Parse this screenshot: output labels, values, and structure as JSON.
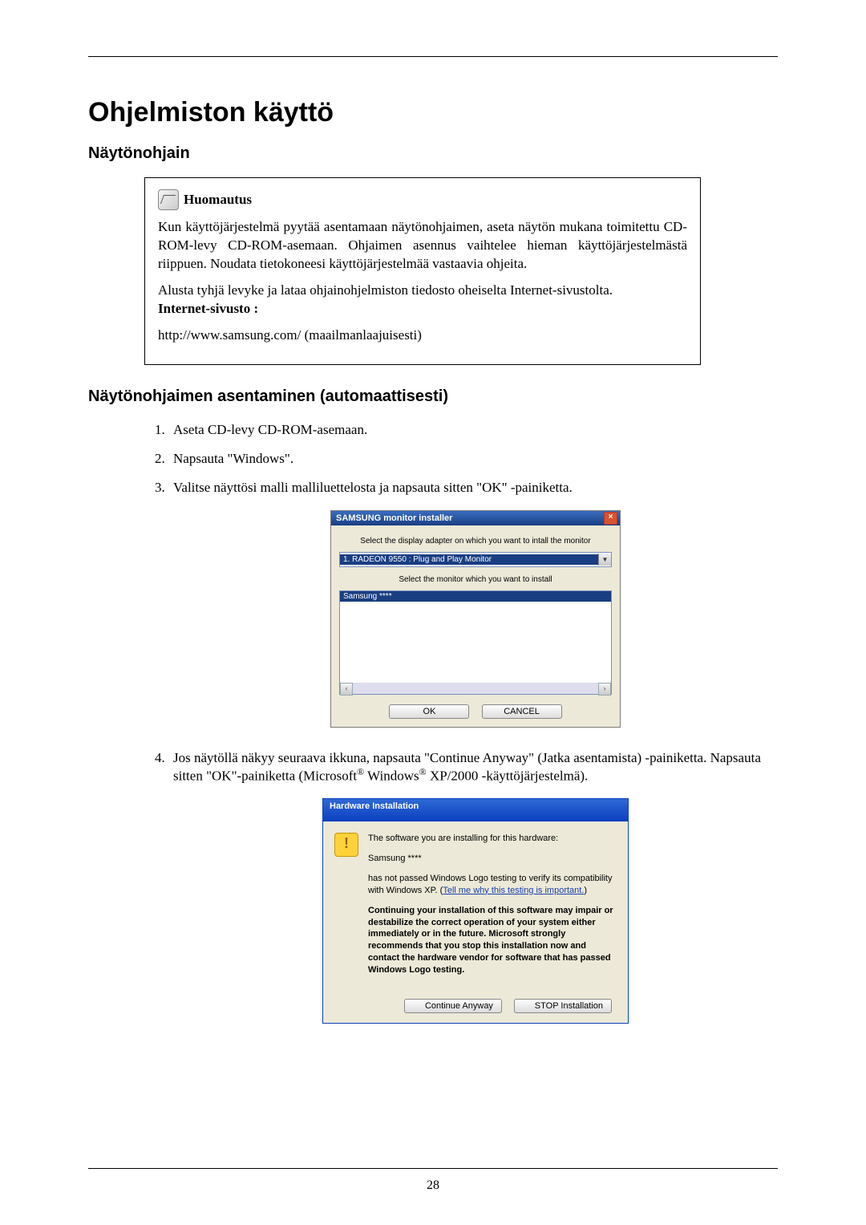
{
  "title": "Ohjelmiston käyttö",
  "section1": "Näytönohjain",
  "note": {
    "label": "Huomautus",
    "p1": "Kun käyttöjärjestelmä pyytää asentamaan näytönohjaimen, aseta näytön mukana toimitettu CD-ROM-levy CD-ROM-asemaan. Ohjaimen asennus vaihtelee hieman käyttöjärjestelmästä riippuen. Noudata tietokoneesi käyttöjärjestelmää vastaavia ohjeita.",
    "p2": "Alusta tyhjä levyke ja lataa ohjainohjelmiston tiedosto oheiselta Internet-sivustolta.",
    "site_label": "Internet-sivusto :",
    "url": "http://www.samsung.com/ (maailmanlaajuisesti)"
  },
  "section2": "Näytönohjaimen asentaminen (automaattisesti)",
  "steps": {
    "s1": "Aseta CD-levy CD-ROM-asemaan.",
    "s2": "Napsauta \"Windows\".",
    "s3": "Valitse näyttösi malli malliluettelosta ja napsauta sitten \"OK\" -painiketta.",
    "s4a": "Jos näytöllä näkyy seuraava ikkuna, napsauta \"Continue Anyway\" (Jatka asentamista) -painiketta. Napsauta sitten \"OK\"-painiketta (Microsoft",
    "s4b": " Windows",
    "s4c": " XP/2000 -käyttöjärjestelmä)."
  },
  "installer": {
    "title": "SAMSUNG monitor installer",
    "instr1": "Select the display adapter on which you want to intall the monitor",
    "combo": "1. RADEON 9550 : Plug and Play Monitor",
    "instr2": "Select the monitor which you want to install",
    "listsel": "Samsung ****",
    "ok": "OK",
    "cancel": "CANCEL"
  },
  "hw": {
    "title": "Hardware Installation",
    "l1": "The software you are installing for this hardware:",
    "l2": "Samsung ****",
    "l3a": "has not passed Windows Logo testing to verify its compatibility with Windows XP. (",
    "l3link": "Tell me why this testing is important.",
    "l3b": ")",
    "l4": "Continuing your installation of this software may impair or destabilize the correct operation of your system either immediately or in the future. Microsoft strongly recommends that you stop this installation now and contact the hardware vendor for software that has passed Windows Logo testing.",
    "btn1": "Continue Anyway",
    "btn2": "STOP Installation"
  },
  "reg": "®",
  "page_number": "28"
}
